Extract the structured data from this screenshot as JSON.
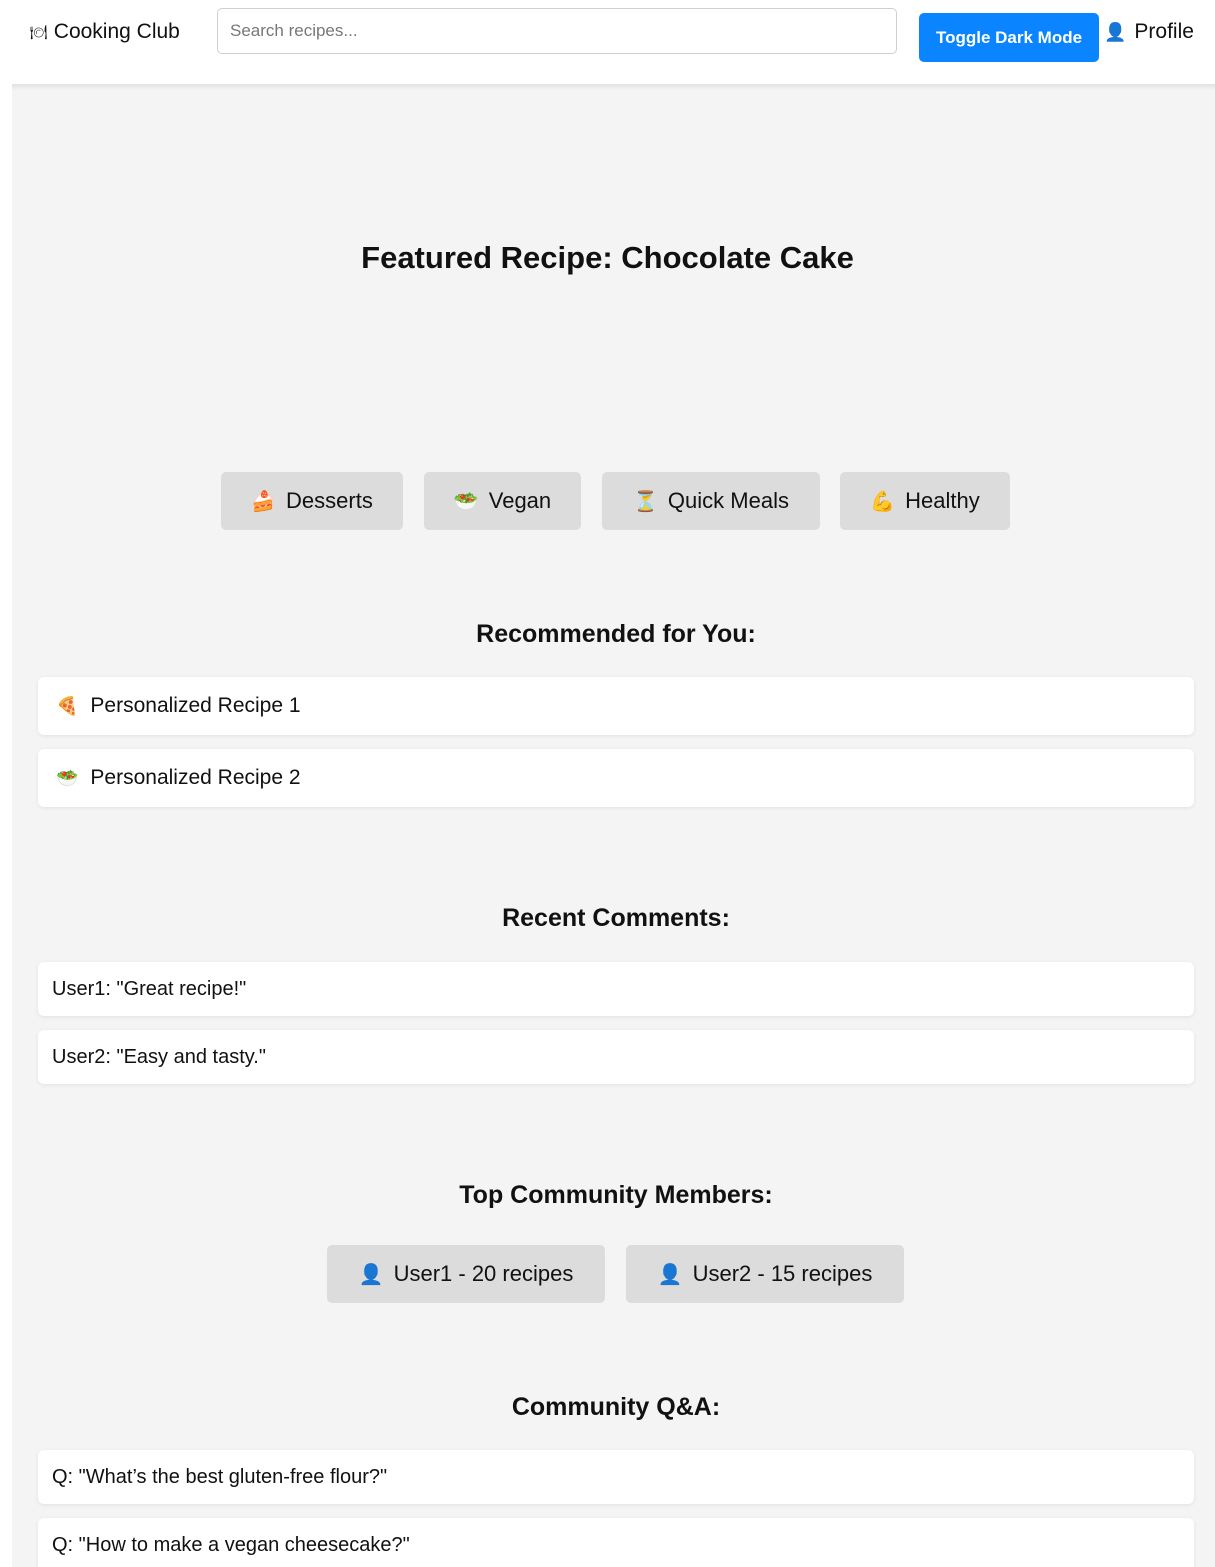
{
  "header": {
    "brand_icon": "🍽",
    "brand_label": "Cooking Club",
    "search_placeholder": "Search recipes...",
    "dark_mode_label": "Toggle Dark Mode",
    "profile_icon": "👤",
    "profile_label": "Profile"
  },
  "featured": {
    "title": "Featured Recipe: Chocolate Cake"
  },
  "categories": [
    {
      "icon": "🍰",
      "label": "Desserts"
    },
    {
      "icon": "🥗",
      "label": "Vegan"
    },
    {
      "icon": "⏳",
      "label": "Quick Meals"
    },
    {
      "icon": "💪",
      "label": "Healthy"
    }
  ],
  "recommended": {
    "title": "Recommended for You:",
    "items": [
      {
        "icon": "🍕",
        "label": "Personalized Recipe 1"
      },
      {
        "icon": "🥗",
        "label": "Personalized Recipe 2"
      }
    ]
  },
  "comments": {
    "title": "Recent Comments:",
    "items": [
      "User1: \"Great recipe!\"",
      "User2: \"Easy and tasty.\""
    ]
  },
  "members": {
    "title": "Top Community Members:",
    "items": [
      {
        "icon": "👤",
        "label": "User1 - 20 recipes"
      },
      {
        "icon": "👤",
        "label": "User2 - 15 recipes"
      }
    ]
  },
  "qa": {
    "title": "Community Q&A:",
    "items": [
      "Q: \"What’s the best gluten-free flour?\"",
      "Q: \"How to make a vegan cheesecake?\""
    ]
  },
  "colors": {
    "accent": "#0a84ff",
    "page_background": "#f4f4f4",
    "pill_background": "#dcdcdc",
    "card_background": "#ffffff"
  }
}
